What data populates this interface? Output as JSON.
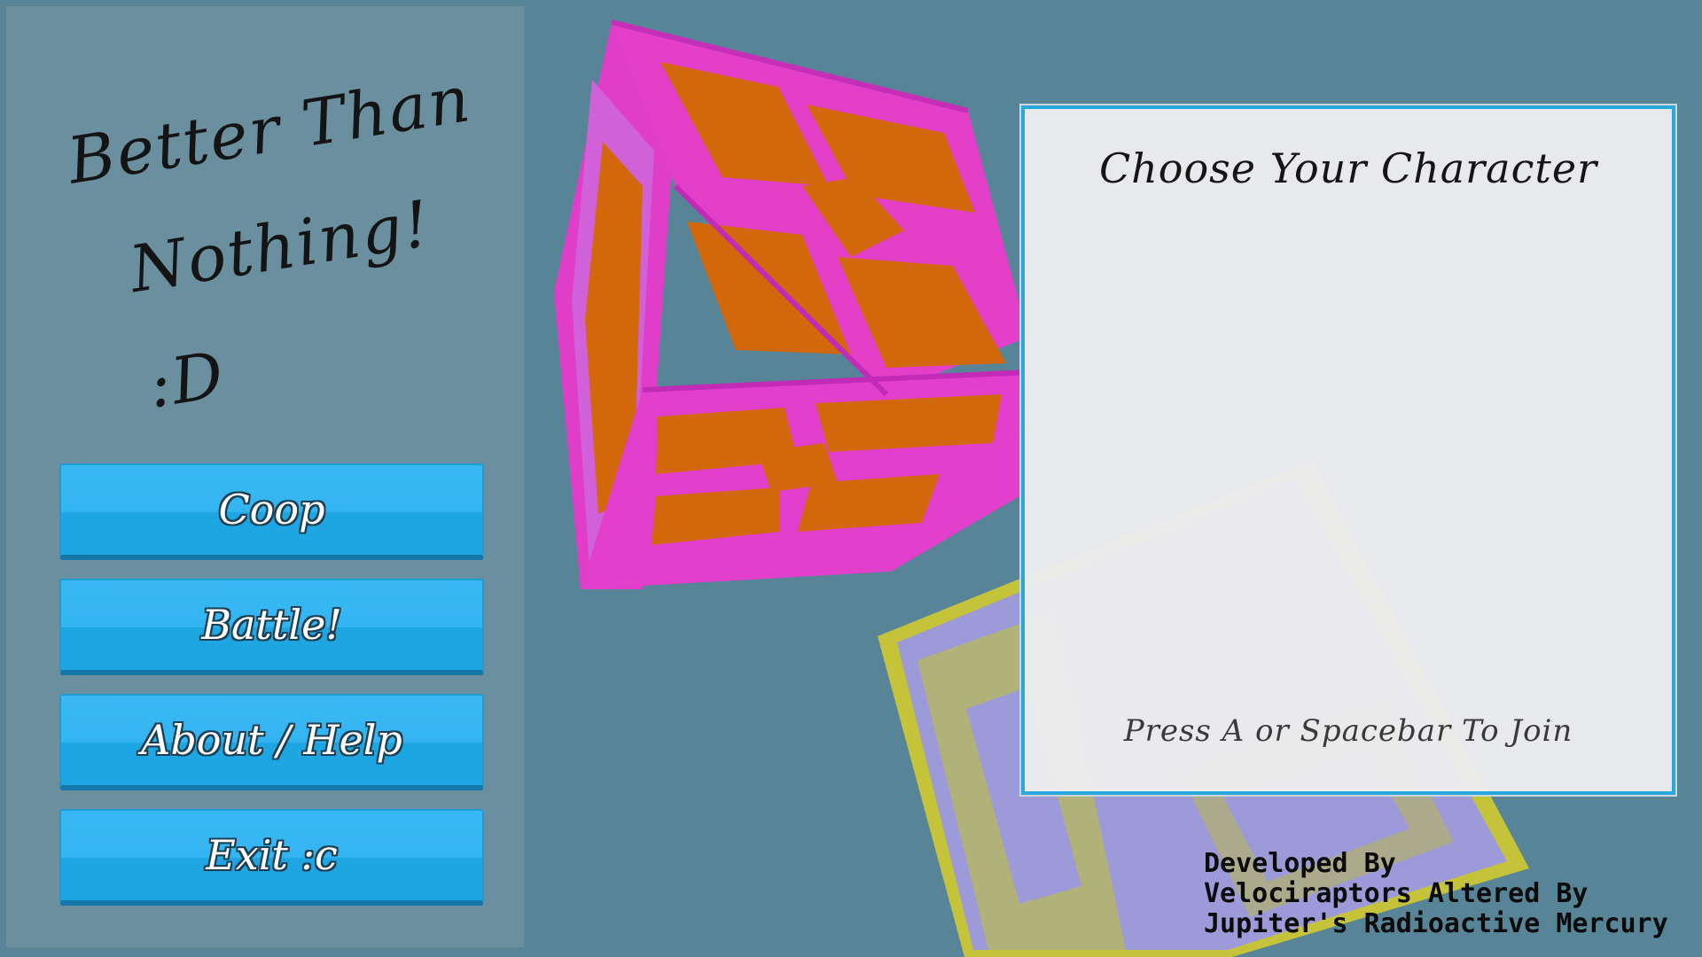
{
  "title": {
    "line1": "Better Than",
    "line2": "Nothing! :D"
  },
  "menu": {
    "coop_label": "Coop",
    "battle_label": "Battle!",
    "about_label": "About / Help",
    "exit_label": "Exit :c"
  },
  "character_select": {
    "heading": "Choose Your Character",
    "join_hint": "Press A or Spacebar To Join"
  },
  "credits": {
    "line1": "Developed By",
    "line2": "Velociraptors Altered By",
    "line3": "Jupiter's Radioactive Mercury"
  },
  "colors": {
    "background": "#588497",
    "panel": "#6a909f",
    "button": "#34b5f1",
    "panel_border": "#2aa7dc",
    "cube_pink": "#e43ed0",
    "cube_magenta": "#d52fe6",
    "cube_orange": "#d3670c",
    "cube_yellow": "#c5c43a",
    "cube_lavender": "#9a9ad6"
  }
}
